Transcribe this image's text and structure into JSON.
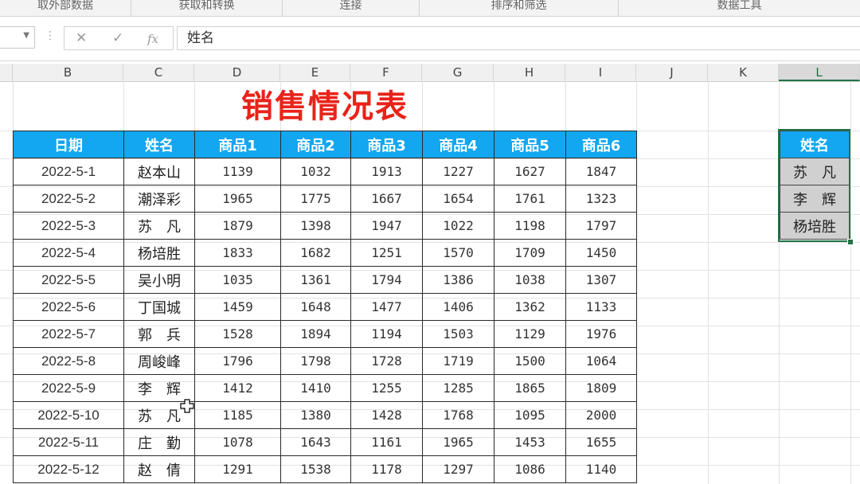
{
  "ribbon": {
    "groups": [
      "取外部数据",
      "获取和转换",
      "连接",
      "排序和筛选",
      "数据工具"
    ]
  },
  "formula_bar": {
    "name_box_value": "",
    "cancel_icon": "close-icon",
    "enter_icon": "check-icon",
    "fx_label": "fx",
    "formula_value": "姓名"
  },
  "columns": [
    "B",
    "C",
    "D",
    "E",
    "F",
    "G",
    "H",
    "I",
    "J",
    "K",
    "L"
  ],
  "selected_column": "L",
  "sheet": {
    "title": "销售情况表",
    "headers": [
      "日期",
      "姓名",
      "商品1",
      "商品2",
      "商品3",
      "商品4",
      "商品5",
      "商品6"
    ],
    "rows": [
      [
        "2022-5-1",
        "赵本山",
        "1139",
        "1032",
        "1913",
        "1227",
        "1627",
        "1847"
      ],
      [
        "2022-5-2",
        "潮泽彩",
        "1965",
        "1775",
        "1667",
        "1654",
        "1761",
        "1323"
      ],
      [
        "2022-5-3",
        "苏　凡",
        "1879",
        "1398",
        "1947",
        "1022",
        "1198",
        "1797"
      ],
      [
        "2022-5-4",
        "杨培胜",
        "1833",
        "1682",
        "1251",
        "1570",
        "1709",
        "1450"
      ],
      [
        "2022-5-5",
        "吴小明",
        "1035",
        "1361",
        "1794",
        "1386",
        "1038",
        "1307"
      ],
      [
        "2022-5-6",
        "丁国城",
        "1459",
        "1648",
        "1477",
        "1406",
        "1362",
        "1133"
      ],
      [
        "2022-5-7",
        "郭　兵",
        "1528",
        "1894",
        "1194",
        "1503",
        "1129",
        "1976"
      ],
      [
        "2022-5-8",
        "周峻峰",
        "1796",
        "1798",
        "1728",
        "1719",
        "1500",
        "1064"
      ],
      [
        "2022-5-9",
        "李　辉",
        "1412",
        "1410",
        "1255",
        "1285",
        "1865",
        "1809"
      ],
      [
        "2022-5-10",
        "苏　凡",
        "1185",
        "1380",
        "1428",
        "1768",
        "1095",
        "2000"
      ],
      [
        "2022-5-11",
        "庄　勤",
        "1078",
        "1643",
        "1161",
        "1965",
        "1453",
        "1655"
      ],
      [
        "2022-5-12",
        "赵　倩",
        "1291",
        "1538",
        "1178",
        "1297",
        "1086",
        "1140"
      ]
    ]
  },
  "lookup": {
    "header": "姓名",
    "values": [
      "苏　凡",
      "李　辉",
      "杨培胜"
    ]
  },
  "colors": {
    "title": "#e8231a",
    "header_bg": "#12a7f0",
    "selection": "#217346",
    "lookup_cell_bg": "#d0d0d0"
  }
}
